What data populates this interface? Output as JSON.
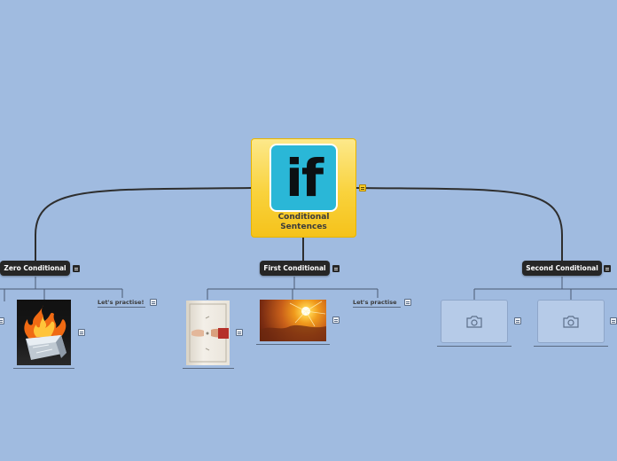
{
  "central": {
    "logo_text": "if",
    "title_line1": "Conditional",
    "title_line2": "Sentences"
  },
  "branches": [
    {
      "label": "Zero Conditional",
      "children": [
        {
          "kind": "image",
          "icon": "burning-ice-cube-image"
        },
        {
          "kind": "text",
          "label": "Let's practise!"
        }
      ]
    },
    {
      "label": "First Conditional",
      "children": [
        {
          "kind": "image",
          "icon": "door-knock-image"
        },
        {
          "kind": "image",
          "icon": "sunset-sky-image"
        },
        {
          "kind": "text",
          "label": "Let's practise"
        }
      ]
    },
    {
      "label": "Second Conditional",
      "children": [
        {
          "kind": "image",
          "icon": "camera-placeholder-icon"
        },
        {
          "kind": "image",
          "icon": "camera-placeholder-icon"
        }
      ]
    }
  ],
  "colors": {
    "background": "#a0bbe0",
    "central_fill": "#f9d23c",
    "logo_fill": "#2ab7d7",
    "branch_node": "#262626",
    "connector": "#333333"
  }
}
